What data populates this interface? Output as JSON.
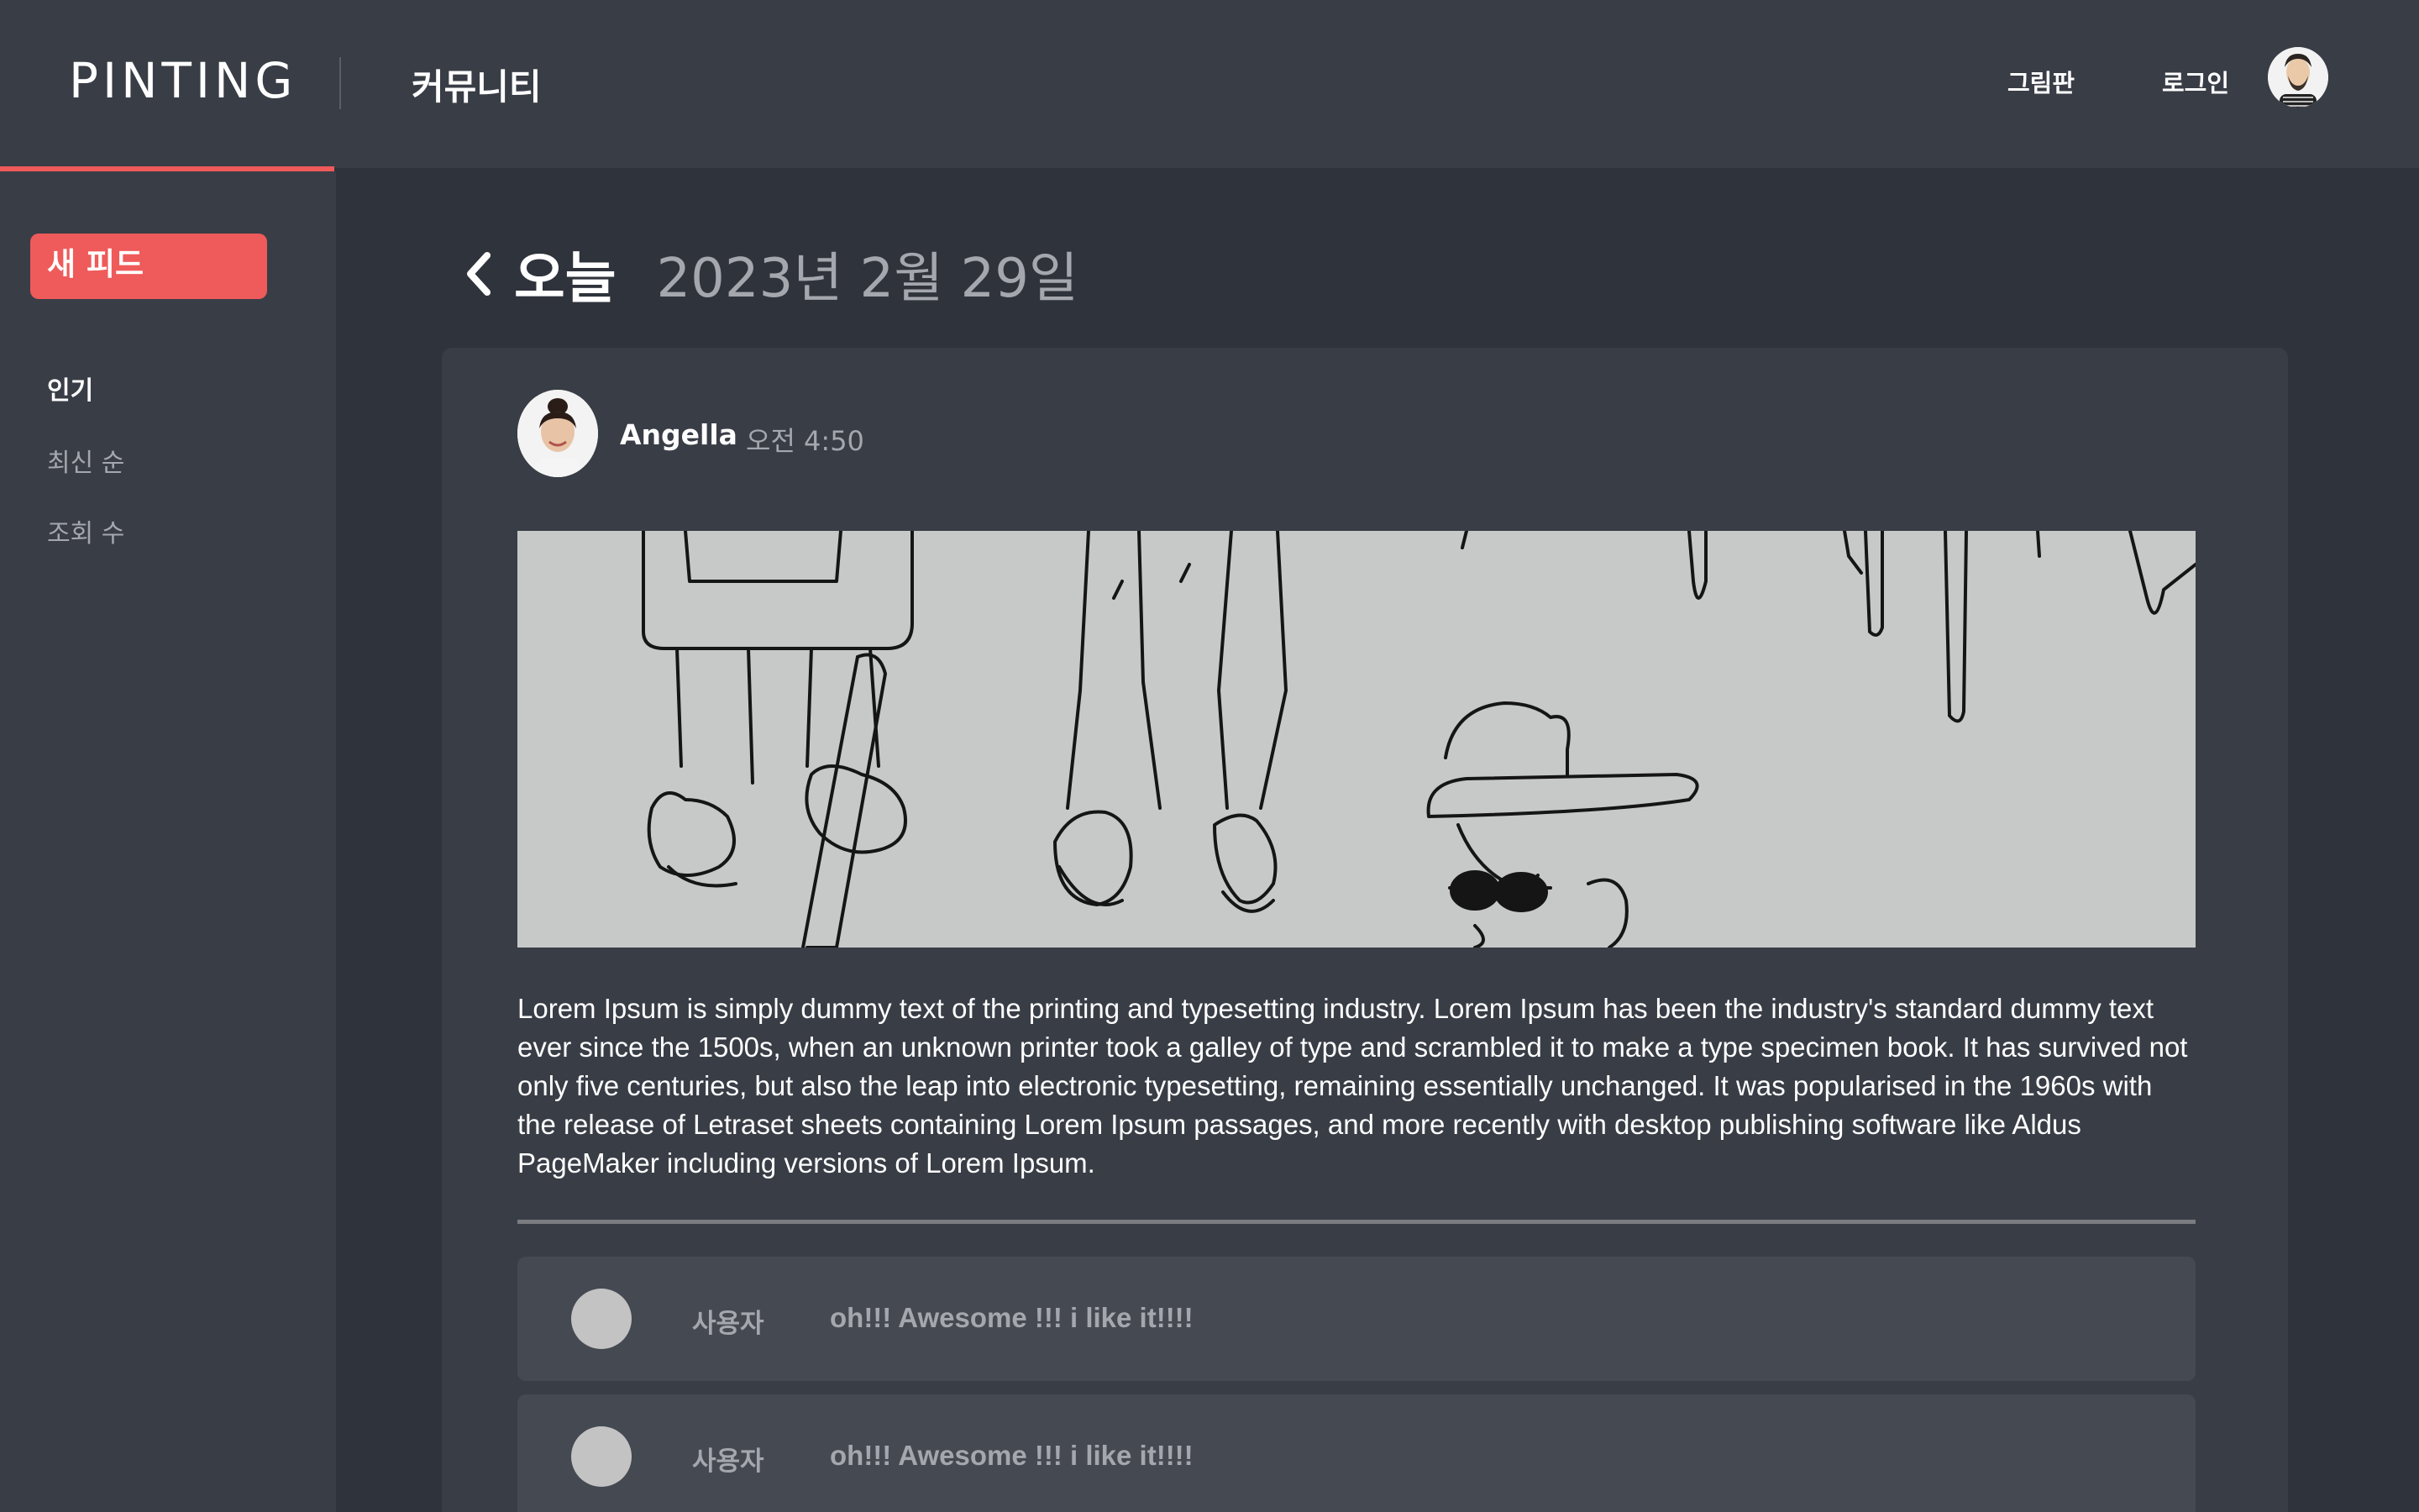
{
  "app": {
    "logo": "PINTING",
    "section_title": "커뮤니티"
  },
  "header": {
    "nav": {
      "gallery": "그림판",
      "login": "로그인"
    },
    "avatar_icon": "user-avatar-icon"
  },
  "sidebar": {
    "new_feed_label": "새 피드",
    "sort_options": [
      "인기",
      "최신 순",
      "조회 수"
    ],
    "active_sort": "인기"
  },
  "page": {
    "back_icon": "chevron-left-icon",
    "heading_today": "오늘",
    "heading_date": "2023년 2월 29일"
  },
  "post": {
    "author": "Angella",
    "time": "오전 4:50",
    "image_icon": "line-drawing-illustration",
    "body": "Lorem Ipsum is simply dummy text of the printing and typesetting industry. Lorem Ipsum has been the industry's standard dummy text ever since the 1500s, when an unknown printer took a galley of type and scrambled it to make a type specimen book. It has survived not only five centuries, but also the leap into electronic typesetting, remaining essentially unchanged. It was popularised in the 1960s with the release of Letraset sheets containing Lorem Ipsum passages, and more recently with desktop publishing software like Aldus PageMaker including versions of Lorem Ipsum."
  },
  "comments": [
    {
      "user": "사용자",
      "text": "oh!!! Awesome !!! i like it!!!!"
    },
    {
      "user": "사용자",
      "text": "oh!!! Awesome !!! i like it!!!!"
    }
  ],
  "colors": {
    "accent": "#ef5a5a",
    "background": "#2f333b",
    "panel": "#393d46",
    "comment_bg": "#454952",
    "muted_text": "#a4a7ad"
  }
}
